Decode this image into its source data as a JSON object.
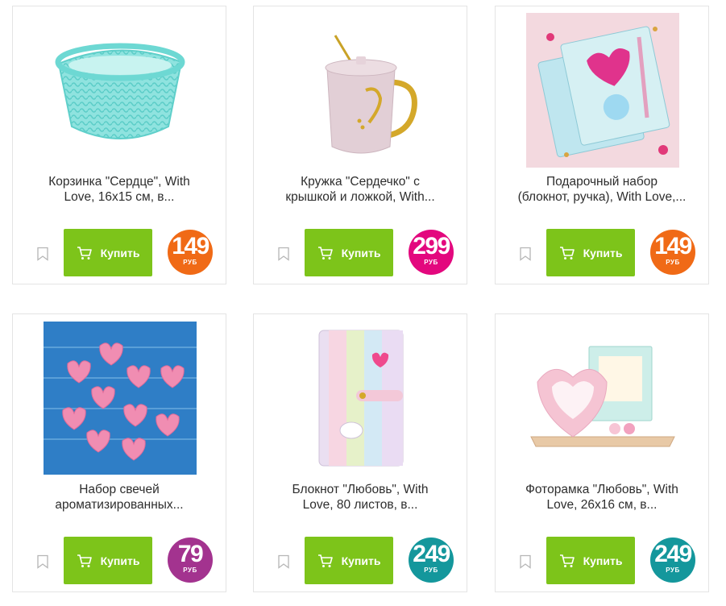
{
  "products": [
    {
      "title_line1": "Корзинка \"Сердце\", With",
      "title_line2": "Love, 16x15 см, в...",
      "buy_label": "Купить",
      "price": "149",
      "currency": "РУБ",
      "price_color": "#f06a16"
    },
    {
      "title_line1": "Кружка \"Сердечко\" с",
      "title_line2": "крышкой и ложкой, With...",
      "buy_label": "Купить",
      "price": "299",
      "currency": "РУБ",
      "price_color": "#e3087e"
    },
    {
      "title_line1": "Подарочный набор",
      "title_line2": "(блокнот, ручка), With Love,...",
      "buy_label": "Купить",
      "price": "149",
      "currency": "РУБ",
      "price_color": "#f06a16"
    },
    {
      "title_line1": "Набор свечей",
      "title_line2": "ароматизированных...",
      "buy_label": "Купить",
      "price": "79",
      "currency": "РУБ",
      "price_color": "#a3338f"
    },
    {
      "title_line1": "Блокнот \"Любовь\", With",
      "title_line2": "Love, 80 листов, в...",
      "buy_label": "Купить",
      "price": "249",
      "currency": "РУБ",
      "price_color": "#14979c"
    },
    {
      "title_line1": "Фоторамка \"Любовь\", With",
      "title_line2": "Love, 26x16 см, в...",
      "buy_label": "Купить",
      "price": "249",
      "currency": "РУБ",
      "price_color": "#14979c"
    }
  ],
  "icons": {
    "favorite": "bookmark-icon",
    "cart": "cart-icon"
  },
  "colors": {
    "buy_button": "#7dc41a",
    "card_border": "#e4e4e4"
  }
}
